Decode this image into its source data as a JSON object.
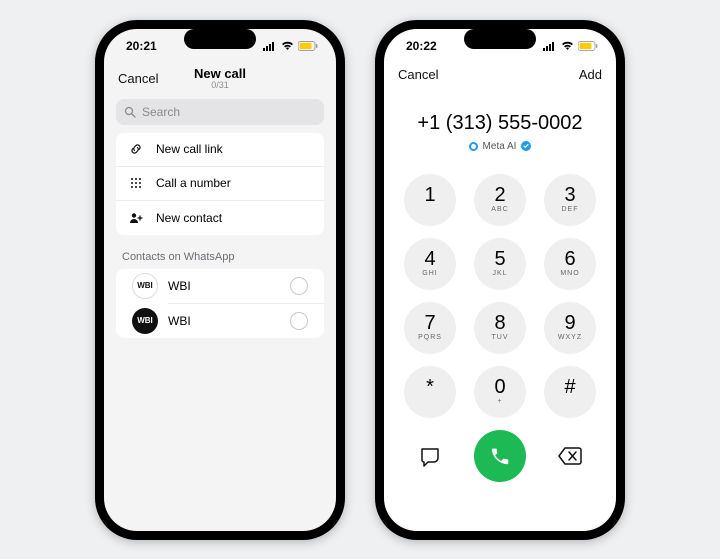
{
  "left": {
    "status_time": "20:21",
    "nav_cancel": "Cancel",
    "nav_title": "New call",
    "nav_sub": "0/31",
    "search_placeholder": "Search",
    "actions": {
      "new_call_link": "New call link",
      "call_number": "Call a number",
      "new_contact": "New contact"
    },
    "section_header": "Contacts on WhatsApp",
    "contacts": [
      {
        "avatar": "WBI",
        "name": "WBI"
      },
      {
        "avatar": "WBI",
        "name": "WBI"
      }
    ]
  },
  "right": {
    "status_time": "20:22",
    "nav_cancel": "Cancel",
    "nav_add": "Add",
    "dialed_number": "+1 (313) 555-0002",
    "meta_label": "Meta AI",
    "keys": [
      {
        "n": "1",
        "l": ""
      },
      {
        "n": "2",
        "l": "ABC"
      },
      {
        "n": "3",
        "l": "DEF"
      },
      {
        "n": "4",
        "l": "GHI"
      },
      {
        "n": "5",
        "l": "JKL"
      },
      {
        "n": "6",
        "l": "MNO"
      },
      {
        "n": "7",
        "l": "PQRS"
      },
      {
        "n": "8",
        "l": "TUV"
      },
      {
        "n": "9",
        "l": "WXYZ"
      },
      {
        "n": "*",
        "l": ""
      },
      {
        "n": "0",
        "l": "+"
      },
      {
        "n": "#",
        "l": ""
      }
    ]
  }
}
